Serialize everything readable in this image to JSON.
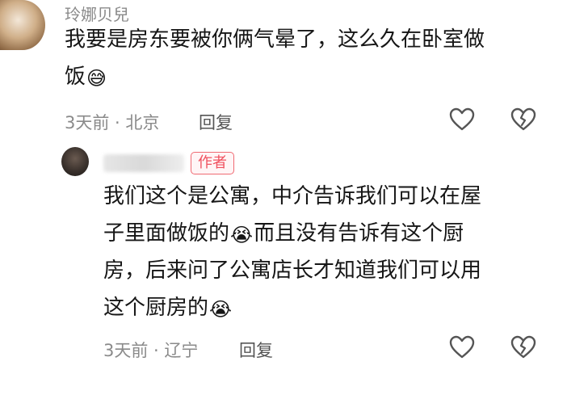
{
  "comment": {
    "username": "玲娜贝兒",
    "lines": [
      "我要是房东要被你俩气晕了，这么久在卧室做",
      "饭"
    ],
    "emoji": "😅",
    "timestamp": "3天前 · 北京",
    "reply_label": "回复"
  },
  "reply": {
    "badge": "作者",
    "line1": "我们这个是公寓，中介告诉我们可以在屋",
    "line2_a": "子里面做饭的",
    "line2_b": "而且没有告诉有这个厨",
    "line3": "房，后来问了公寓店长才知道我们可以用",
    "line4": "这个厨房的",
    "emoji": "😭",
    "timestamp": "3天前 · 辽宁",
    "reply_label": "回复"
  },
  "icons": {
    "like": "heart-outline-icon",
    "dislike": "broken-heart-icon"
  }
}
